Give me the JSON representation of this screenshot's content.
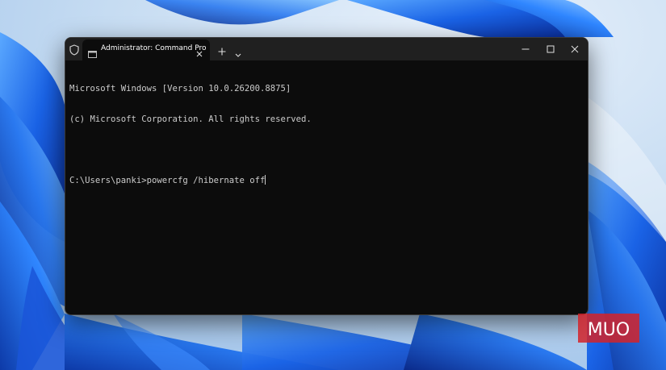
{
  "window": {
    "tab_title": "Administrator: Command Pro"
  },
  "console": {
    "lines": [
      "Microsoft Windows [Version 10.0.26200.8875]",
      "(c) Microsoft Corporation. All rights reserved.",
      ""
    ],
    "prompt": "C:\\Users\\panki>",
    "command": "powercfg /hibernate off"
  },
  "icons": {
    "shield": "shield-icon",
    "tab": "terminal-icon",
    "tab_close": "close-icon",
    "new_tab": "plus-icon",
    "dropdown": "chevron-down-icon",
    "minimize": "minimize-icon",
    "maximize": "maximize-icon",
    "close": "close-icon"
  },
  "watermark": {
    "text": "MUO"
  },
  "colors": {
    "console_bg": "#0c0c0c",
    "console_text": "#cccccc",
    "titlebar_bg": "#202020",
    "wallpaper_blue": "#1565e0",
    "logo_red": "#d2232a"
  }
}
